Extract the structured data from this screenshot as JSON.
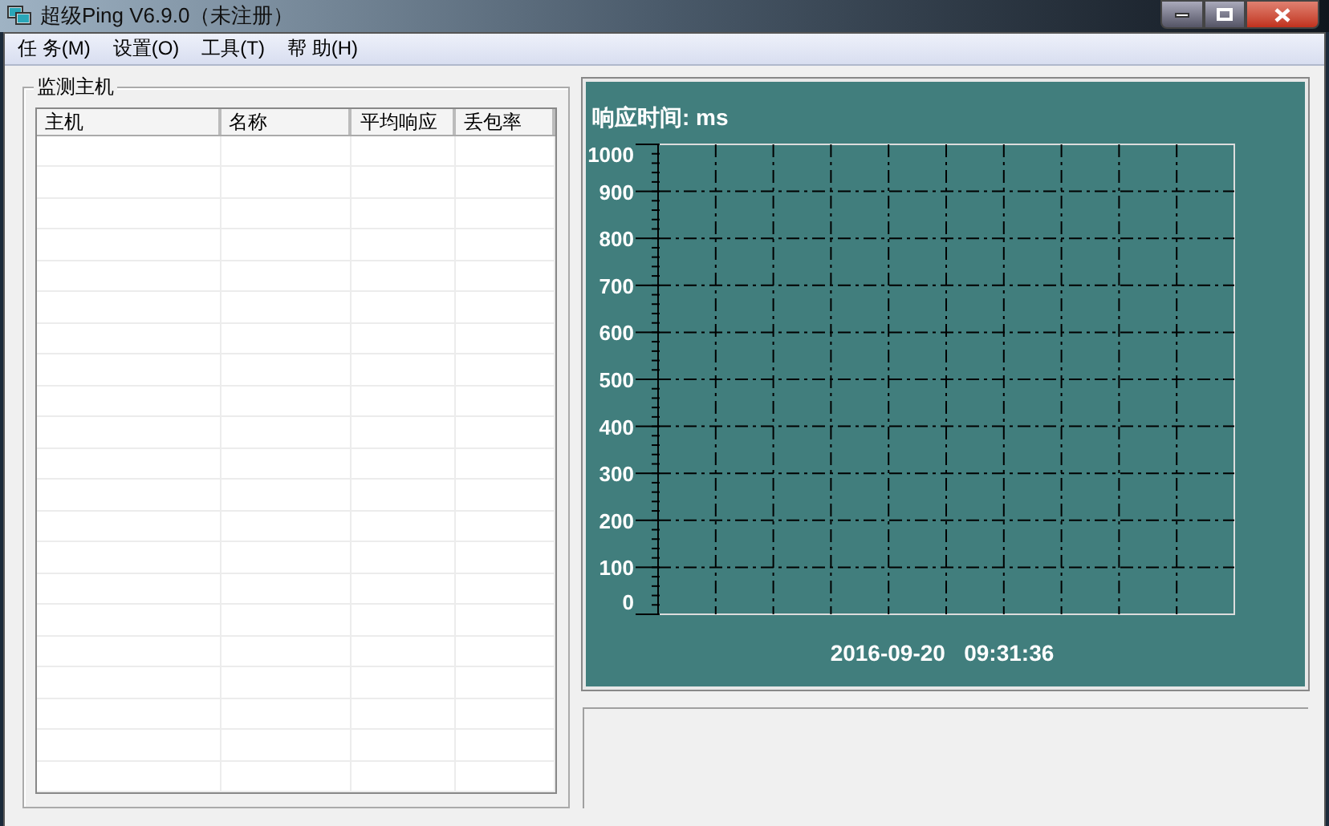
{
  "window": {
    "title": "超级Ping V6.9.0（未注册）"
  },
  "menu": [
    "任 务(M)",
    "设置(O)",
    "工具(T)",
    "帮 助(H)"
  ],
  "hosts_group": {
    "title": "监测主机",
    "columns": [
      "主机",
      "名称",
      "平均响应",
      "丢包率"
    ]
  },
  "response_chart": {
    "title": "响应时间: ms",
    "y_labels": [
      "1000",
      "900",
      "800",
      "700",
      "600",
      "500",
      "400",
      "300",
      "200",
      "100",
      "0"
    ],
    "timestamp": "2016-09-20   09:31:36"
  }
}
